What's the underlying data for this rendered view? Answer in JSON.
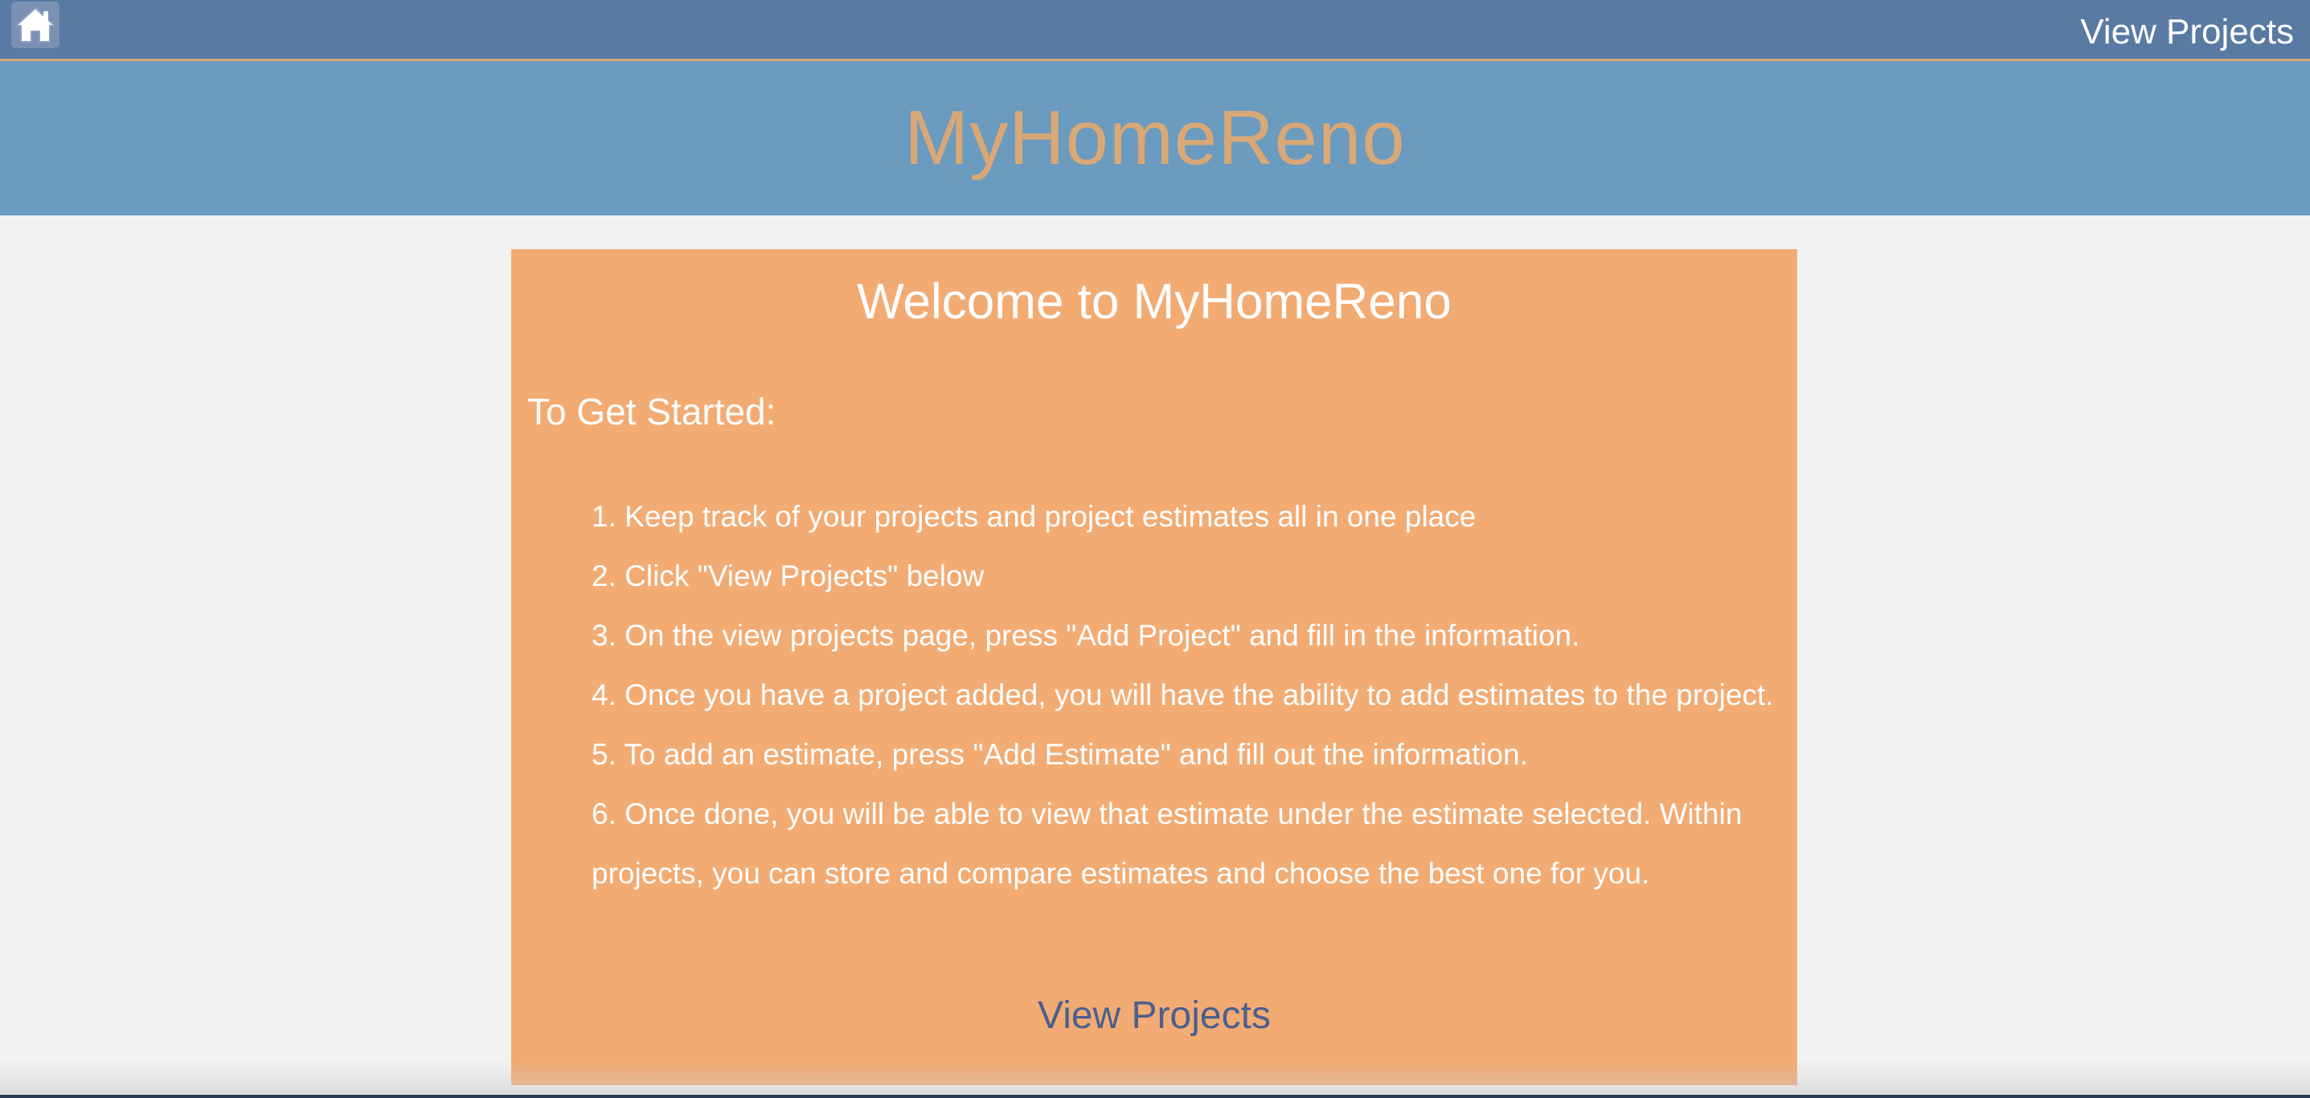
{
  "topnav": {
    "home_icon": "home-icon",
    "view_projects_label": "View Projects"
  },
  "brand": {
    "title": "MyHomeReno"
  },
  "welcome": {
    "title": "Welcome to MyHomeReno",
    "subtitle": "To Get Started:",
    "steps": [
      "1. Keep track of your projects and project estimates all in one place",
      "2. Click \"View Projects\" below",
      "3. On the view projects page, press \"Add Project\" and fill in the information.",
      "4. Once you have a project added, you will have the ability to add estimates to the project.",
      "5. To add an estimate, press \"Add Estimate\" and fill out the information.",
      "6. Once done, you will be able to view that estimate under the estimate selected. Within projects, you can store and compare estimates and choose the best one for you."
    ],
    "link_label": "View Projects"
  },
  "colors": {
    "nav_bg": "#587aa3",
    "brand_bg": "#6b9bbf",
    "brand_text": "#d9a876",
    "card_bg": "#f2ab73",
    "link_text": "#4a5f8f"
  }
}
